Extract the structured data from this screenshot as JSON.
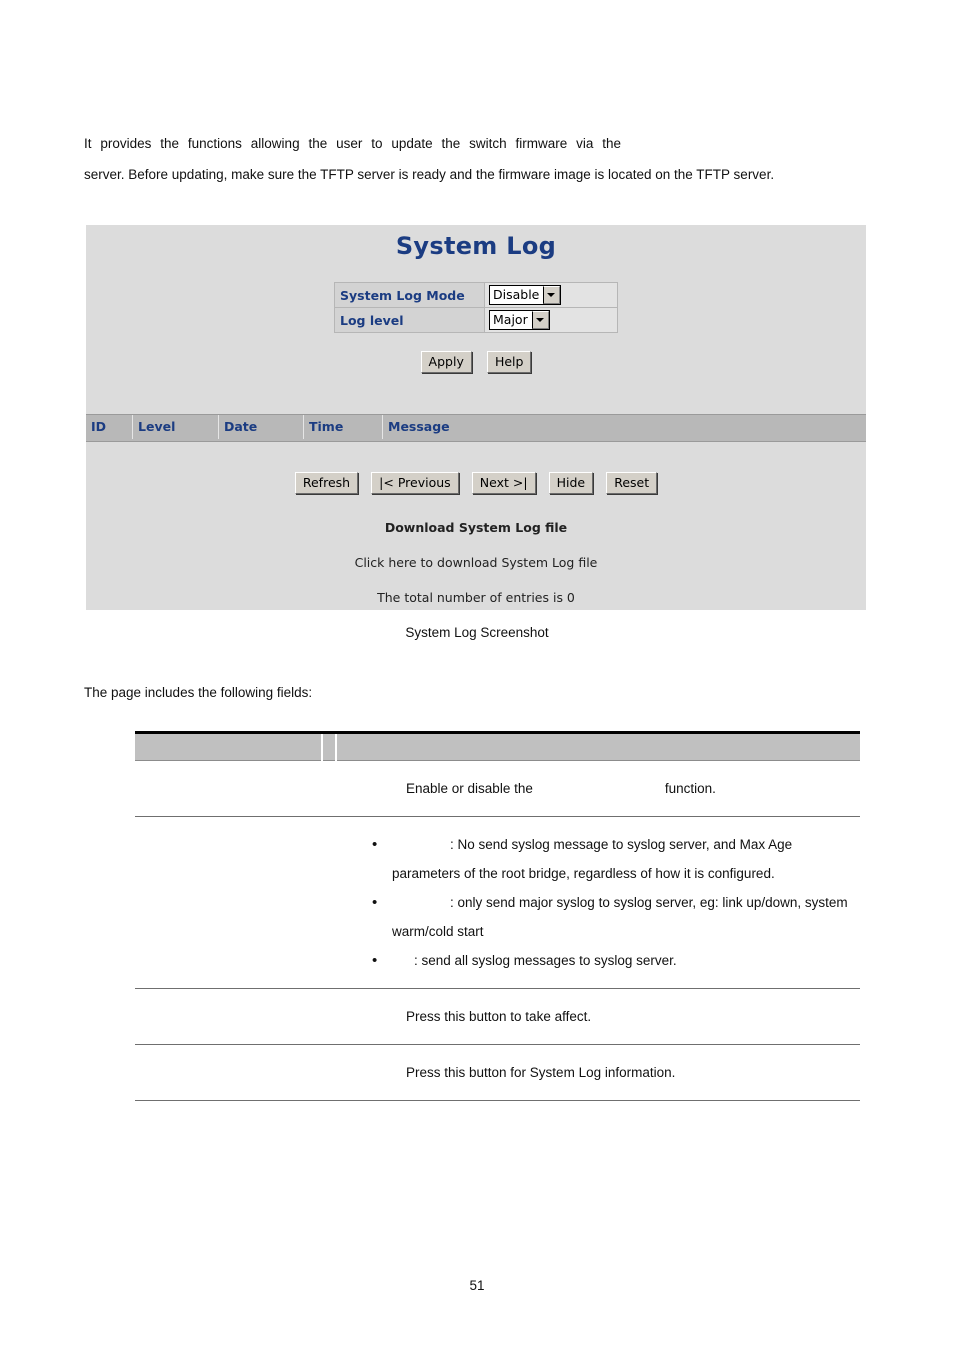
{
  "intro": {
    "line1": "It provides the functions allowing the user to update the switch firmware via the",
    "line2": "server. Before updating, make sure the TFTP server is ready and the firmware image is located on the TFTP server."
  },
  "screenshot": {
    "title": "System Log",
    "form": {
      "rows": [
        {
          "label": "System Log Mode",
          "value": "Disable"
        },
        {
          "label": "Log level",
          "value": "Major"
        }
      ]
    },
    "actions": {
      "apply": "Apply",
      "help": "Help"
    },
    "log_table": {
      "columns": [
        "ID",
        "Level",
        "Date",
        "Time",
        "Message"
      ],
      "rows": []
    },
    "nav_buttons": {
      "refresh": "Refresh",
      "previous": "|< Previous",
      "next": "Next >|",
      "hide": "Hide",
      "reset": "Reset"
    },
    "download": {
      "title": "Download System Log file",
      "link": "Click here to download System Log file",
      "count": "The total number of entries is 0"
    },
    "colors": {
      "panel_bg": "#dcdcdc",
      "title_blue": "#1b3c82",
      "header_band": "#b8b8b8",
      "button_face": "#d4d0c8"
    }
  },
  "caption": "System Log Screenshot",
  "lead_in": "The page includes the following fields:",
  "fields_table": {
    "header": {
      "object": "",
      "divider": "",
      "description": ""
    },
    "rows": [
      {
        "key": "",
        "type": "plain",
        "text_before": "Enable or disable the",
        "text_after": "function."
      },
      {
        "key": "",
        "type": "bullets",
        "bullets": [
          ": No send syslog message to syslog server, and Max Age parameters of the root bridge, regardless of how it is configured.",
          ": only send major syslog to syslog server, eg: link up/down, system warm/cold start",
          ": send all syslog messages to syslog server."
        ]
      },
      {
        "key": "",
        "type": "plain",
        "text_before": "Press this button to take affect.",
        "text_after": ""
      },
      {
        "key": "",
        "type": "plain",
        "text_before": "Press this button for System Log information.",
        "text_after": ""
      }
    ]
  },
  "page_number": "51"
}
